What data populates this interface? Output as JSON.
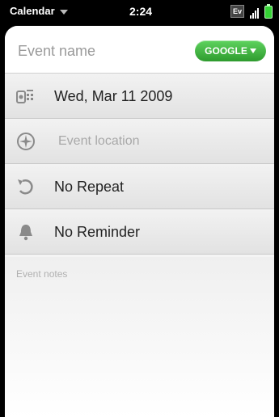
{
  "status_bar": {
    "app_name": "Calendar",
    "time": "2:24",
    "network_badge": "Ev",
    "icons": [
      "app-menu-chevron",
      "signal-bars",
      "battery"
    ]
  },
  "event": {
    "title_placeholder": "Event name",
    "title_value": "",
    "calendar_label": "GOOGLE",
    "date_label": "Wed, Mar 11 2009",
    "location_placeholder": "Event location",
    "repeat_label": "No Repeat",
    "reminder_label": "No Reminder",
    "notes_placeholder": "Event notes"
  },
  "colors": {
    "calendar_pill": "#3cb83c",
    "battery": "#35d135",
    "background": "#000000",
    "card": "#f4f4f4"
  },
  "row_icons": [
    "calendar-date-icon",
    "location-compass-icon",
    "repeat-icon",
    "reminder-bell-icon"
  ]
}
